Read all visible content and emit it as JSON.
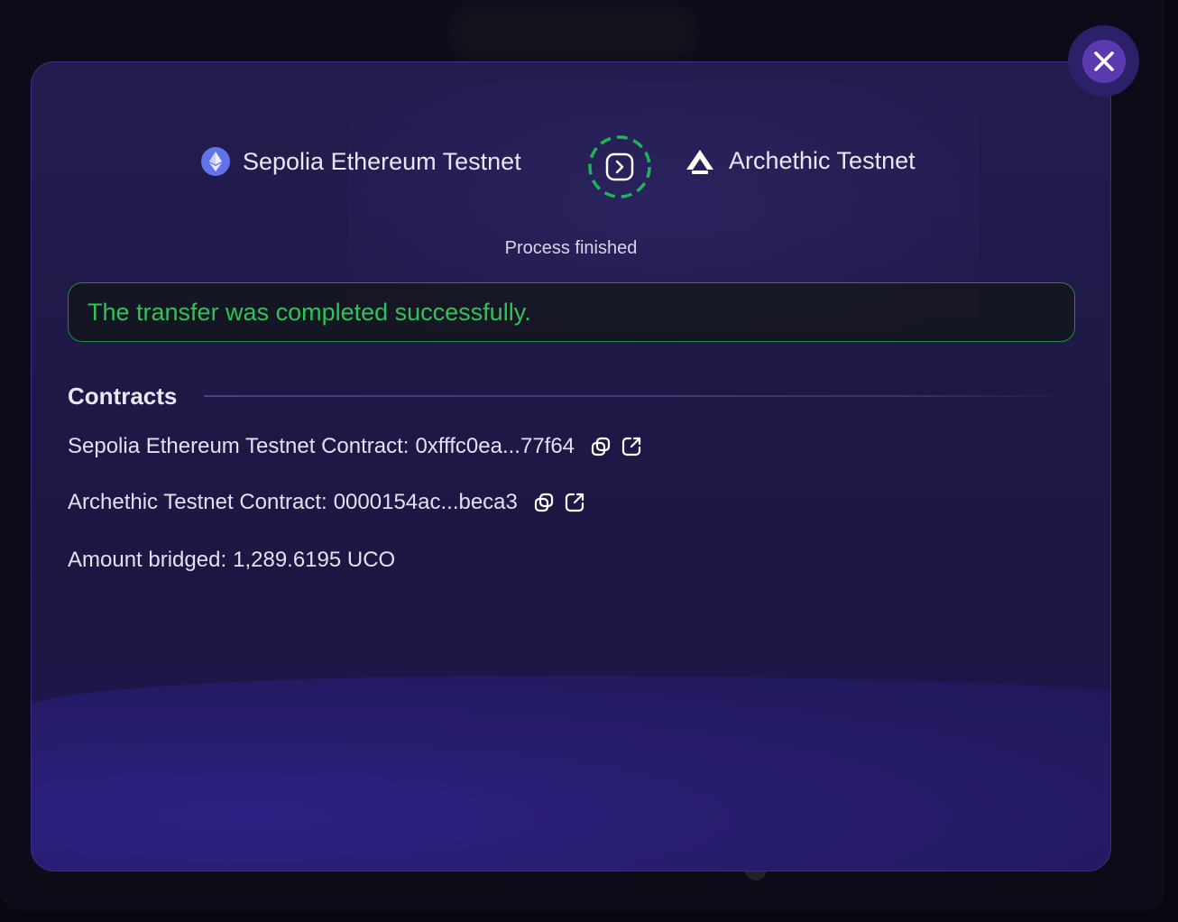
{
  "modal": {
    "close_label": "Close",
    "from_chain": "Sepolia Ethereum Testnet",
    "to_chain": "Archethic Testnet",
    "status": "Process finished",
    "success_message": "The transfer was completed successfully.",
    "contracts_heading": "Contracts",
    "rows": {
      "eth_contract_label": "Sepolia Ethereum Testnet Contract:",
      "eth_contract_value": "0xfffc0ea...77f64",
      "arch_contract_label": "Archethic Testnet Contract:",
      "arch_contract_value": "0000154ac...beca3",
      "amount_label": "Amount bridged:",
      "amount_value": "1,289.6195 UCO"
    }
  },
  "colors": {
    "success": "#2fc357",
    "accent": "#5b3ab1",
    "bridge_ring": "#1fb455"
  },
  "icons": [
    "close-icon",
    "ethereum-icon",
    "bridge-arrow-icon",
    "archethic-icon",
    "copy-icon",
    "external-link-icon"
  ]
}
